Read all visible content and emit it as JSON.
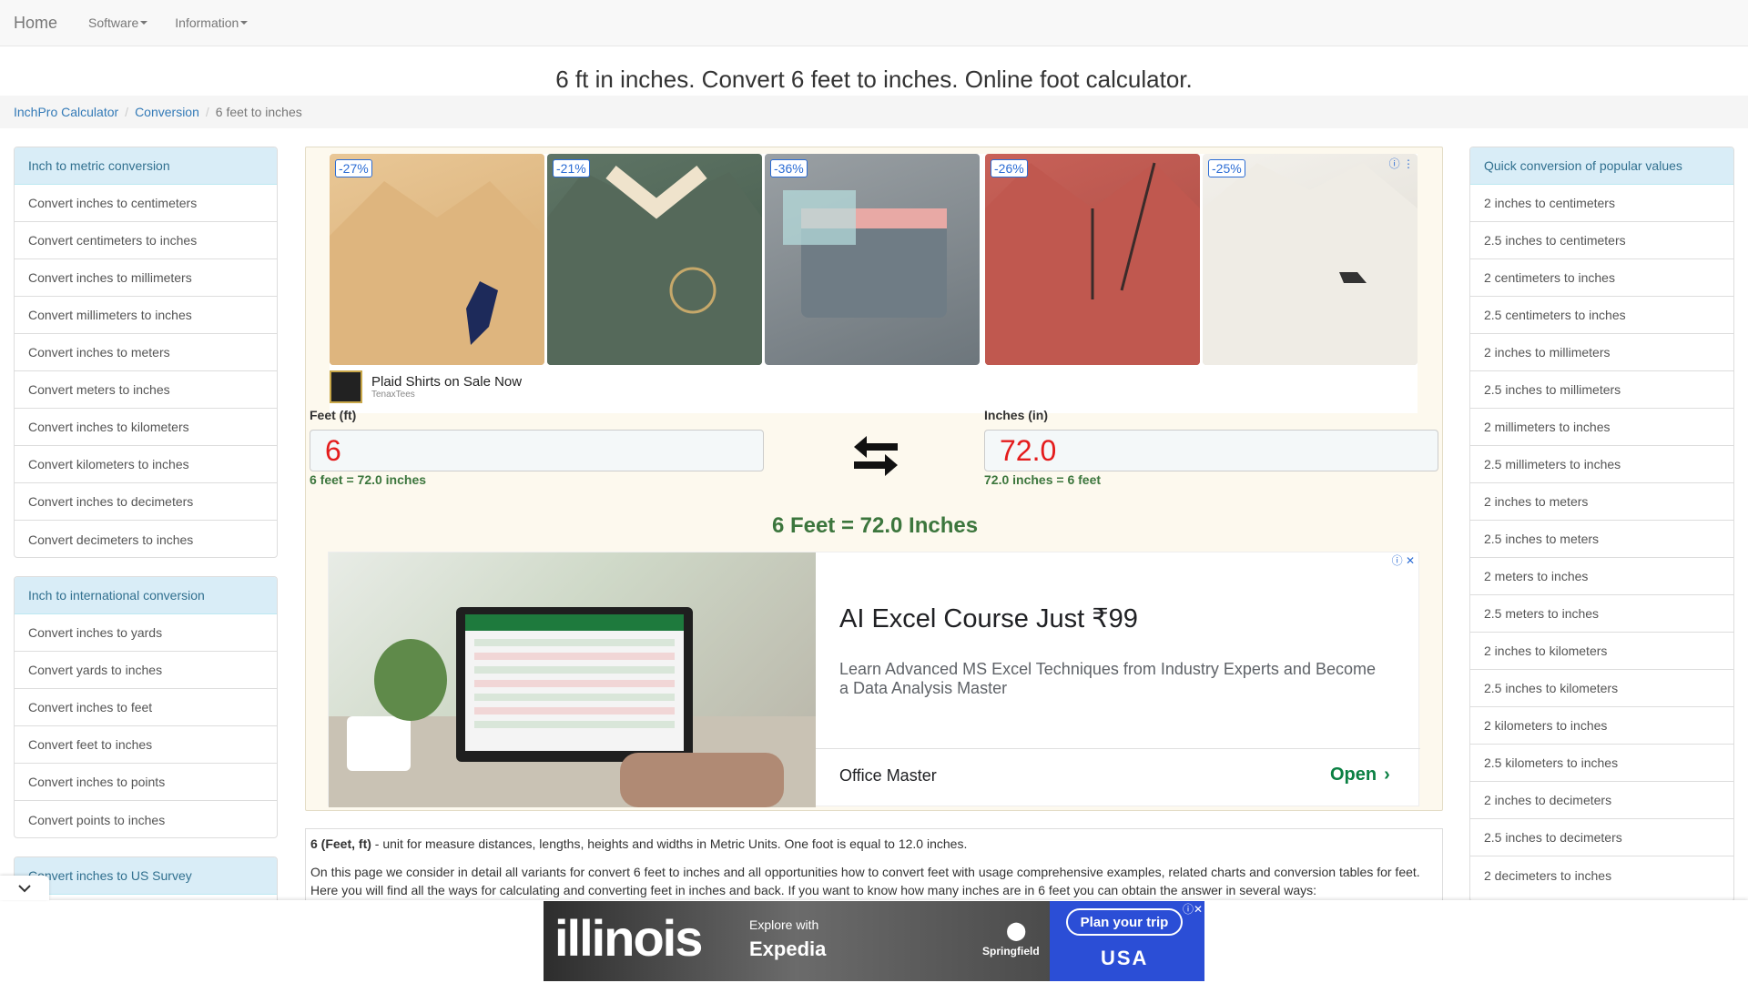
{
  "navbar": {
    "brand": "Home",
    "menus": [
      "Software",
      "Information"
    ]
  },
  "page_title": "6 ft in inches. Convert 6 feet to inches. Online foot calculator.",
  "breadcrumb": [
    "InchPro Calculator",
    "Conversion",
    "6 feet to inches"
  ],
  "left_panels": [
    {
      "heading": "Inch to metric conversion",
      "items": [
        "Convert inches to centimeters",
        "Convert centimeters to inches",
        "Convert inches to millimeters",
        "Convert millimeters to inches",
        "Convert inches to meters",
        "Convert meters to inches",
        "Convert inches to kilometers",
        "Convert kilometers to inches",
        "Convert inches to decimeters",
        "Convert decimeters to inches"
      ]
    },
    {
      "heading": "Inch to international conversion",
      "items": [
        "Convert inches to yards",
        "Convert yards to inches",
        "Convert inches to feet",
        "Convert feet to inches",
        "Convert inches to points",
        "Convert points to inches"
      ]
    },
    {
      "heading": "Convert inches to US Survey",
      "items": []
    }
  ],
  "right_panel": {
    "heading": "Quick conversion of popular values",
    "items": [
      "2 inches to centimeters",
      "2.5 inches to centimeters",
      "2 centimeters to inches",
      "2.5 centimeters to inches",
      "2 inches to millimeters",
      "2.5 inches to millimeters",
      "2 millimeters to inches",
      "2.5 millimeters to inches",
      "2 inches to meters",
      "2.5 inches to meters",
      "2 meters to inches",
      "2.5 meters to inches",
      "2 inches to kilometers",
      "2.5 inches to kilometers",
      "2 kilometers to inches",
      "2.5 kilometers to inches",
      "2 inches to decimeters",
      "2.5 inches to decimeters",
      "2 decimeters to inches"
    ]
  },
  "ad_top": {
    "discounts": [
      "-27%",
      "-21%",
      "-36%",
      "-26%",
      "-25%"
    ],
    "title": "Plaid Shirts on Sale Now",
    "advertiser": "TenaxTees"
  },
  "converter": {
    "feet_label": "Feet (ft)",
    "feet_value": "6",
    "feet_hint": "6 feet = 72.0 inches",
    "inches_label": "Inches (in)",
    "inches_value": "72.0",
    "inches_hint": "72.0 inches = 6 feet",
    "result": "6 Feet = 72.0 Inches"
  },
  "ad_mid": {
    "title": "AI Excel Course Just ₹99",
    "description": "Learn Advanced MS Excel Techniques from Industry Experts and Become a Data Analysis Master",
    "brand": "Office Master",
    "cta": "Open"
  },
  "description": {
    "term": "6 (Feet, ft)",
    "line1": " - unit for measure distances, lengths, heights and widths in Metric Units. One foot is equal to 12.0 inches.",
    "line2": "On this page we consider in detail all variants for convert 6 feet to inches and all opportunities how to convert feet with usage comprehensive examples, related charts and conversion tables for feet. Here you will find all the ways for calculating and converting feet in inches and back. If you want to know how many inches are in 6 feet you can obtain the answer in several ways:"
  },
  "bottom_ad": {
    "brand": "illinois",
    "explore": "Explore with",
    "partner": "Expedia",
    "city": "Springfield",
    "cta": "Plan your trip",
    "badge": "USA"
  }
}
